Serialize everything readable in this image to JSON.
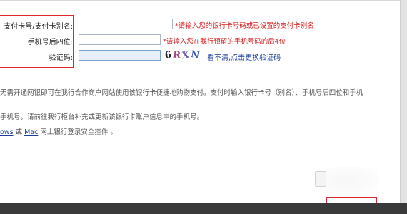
{
  "form": {
    "card_label": "支付卡号/支付卡别名:",
    "card_hint": "请输入您的银行卡号码或已设置的支付卡别名",
    "phone_label": "手机号后四位:",
    "phone_hint": "请输入您在我行预留的手机号码的后4位",
    "captcha_label": "验证码:",
    "captcha_text": [
      "6",
      "R",
      "X",
      "N"
    ],
    "refresh_link": "看不清,点击更换验证码",
    "required_mark": "*"
  },
  "notes": {
    "line1": "无需开通网银即可在我行合作商户网站使用该银行卡便捷地购物支付。支付时输入银行卡号（别名）、手机号后四位和手机",
    "line2": "手机号，请前往我行柜台补充或更新该银行卡账户信息中的手机号。",
    "line3_link1": "ows",
    "line3_or": " 或 ",
    "line3_link2": "Mac",
    "line3_rest": " 网上银行登录安全控件 。"
  },
  "colors": {
    "highlight": "#e0262b",
    "hint_red": "#d61f1f",
    "link_blue": "#1b3f9c"
  }
}
